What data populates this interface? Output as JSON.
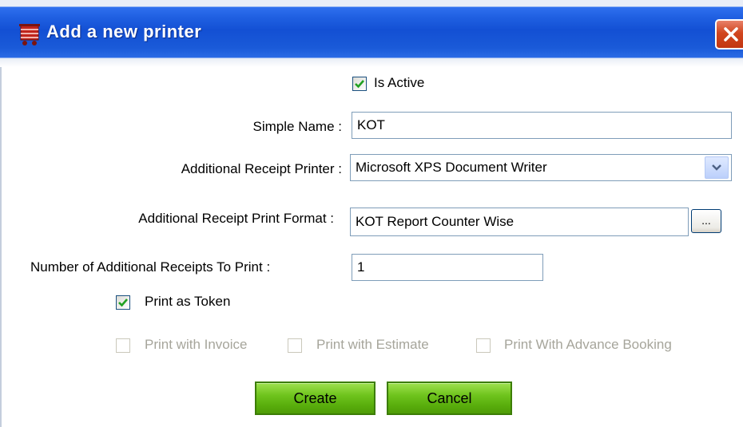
{
  "window": {
    "title": "Add a new printer",
    "icon": "cart-icon",
    "close_icon": "close-icon"
  },
  "form": {
    "is_active": {
      "label": "Is Active",
      "checked": true
    },
    "simple_name": {
      "label": "Simple Name :",
      "value": "KOT"
    },
    "receipt_printer": {
      "label": "Additional Receipt Printer :",
      "value": "Microsoft XPS Document Writer"
    },
    "print_format": {
      "label": "Additional Receipt Print Format :",
      "value": "KOT Report Counter Wise",
      "browse_label": "..."
    },
    "receipt_count": {
      "label": "Number of Additional Receipts To Print :",
      "value": "1"
    },
    "print_as_token": {
      "label": "Print as Token",
      "checked": true
    },
    "print_with_invoice": {
      "label": "Print with Invoice",
      "checked": false,
      "enabled": false
    },
    "print_with_estimate": {
      "label": "Print with Estimate",
      "checked": false,
      "enabled": false
    },
    "print_with_advance_booking": {
      "label": "Print With Advance Booking",
      "checked": false,
      "enabled": false
    }
  },
  "buttons": {
    "create": "Create",
    "cancel": "Cancel"
  },
  "colors": {
    "titlebar": "#1350d4",
    "button_green": "#6fc41d",
    "close_red": "#d1461f",
    "check_green": "#21a121"
  }
}
